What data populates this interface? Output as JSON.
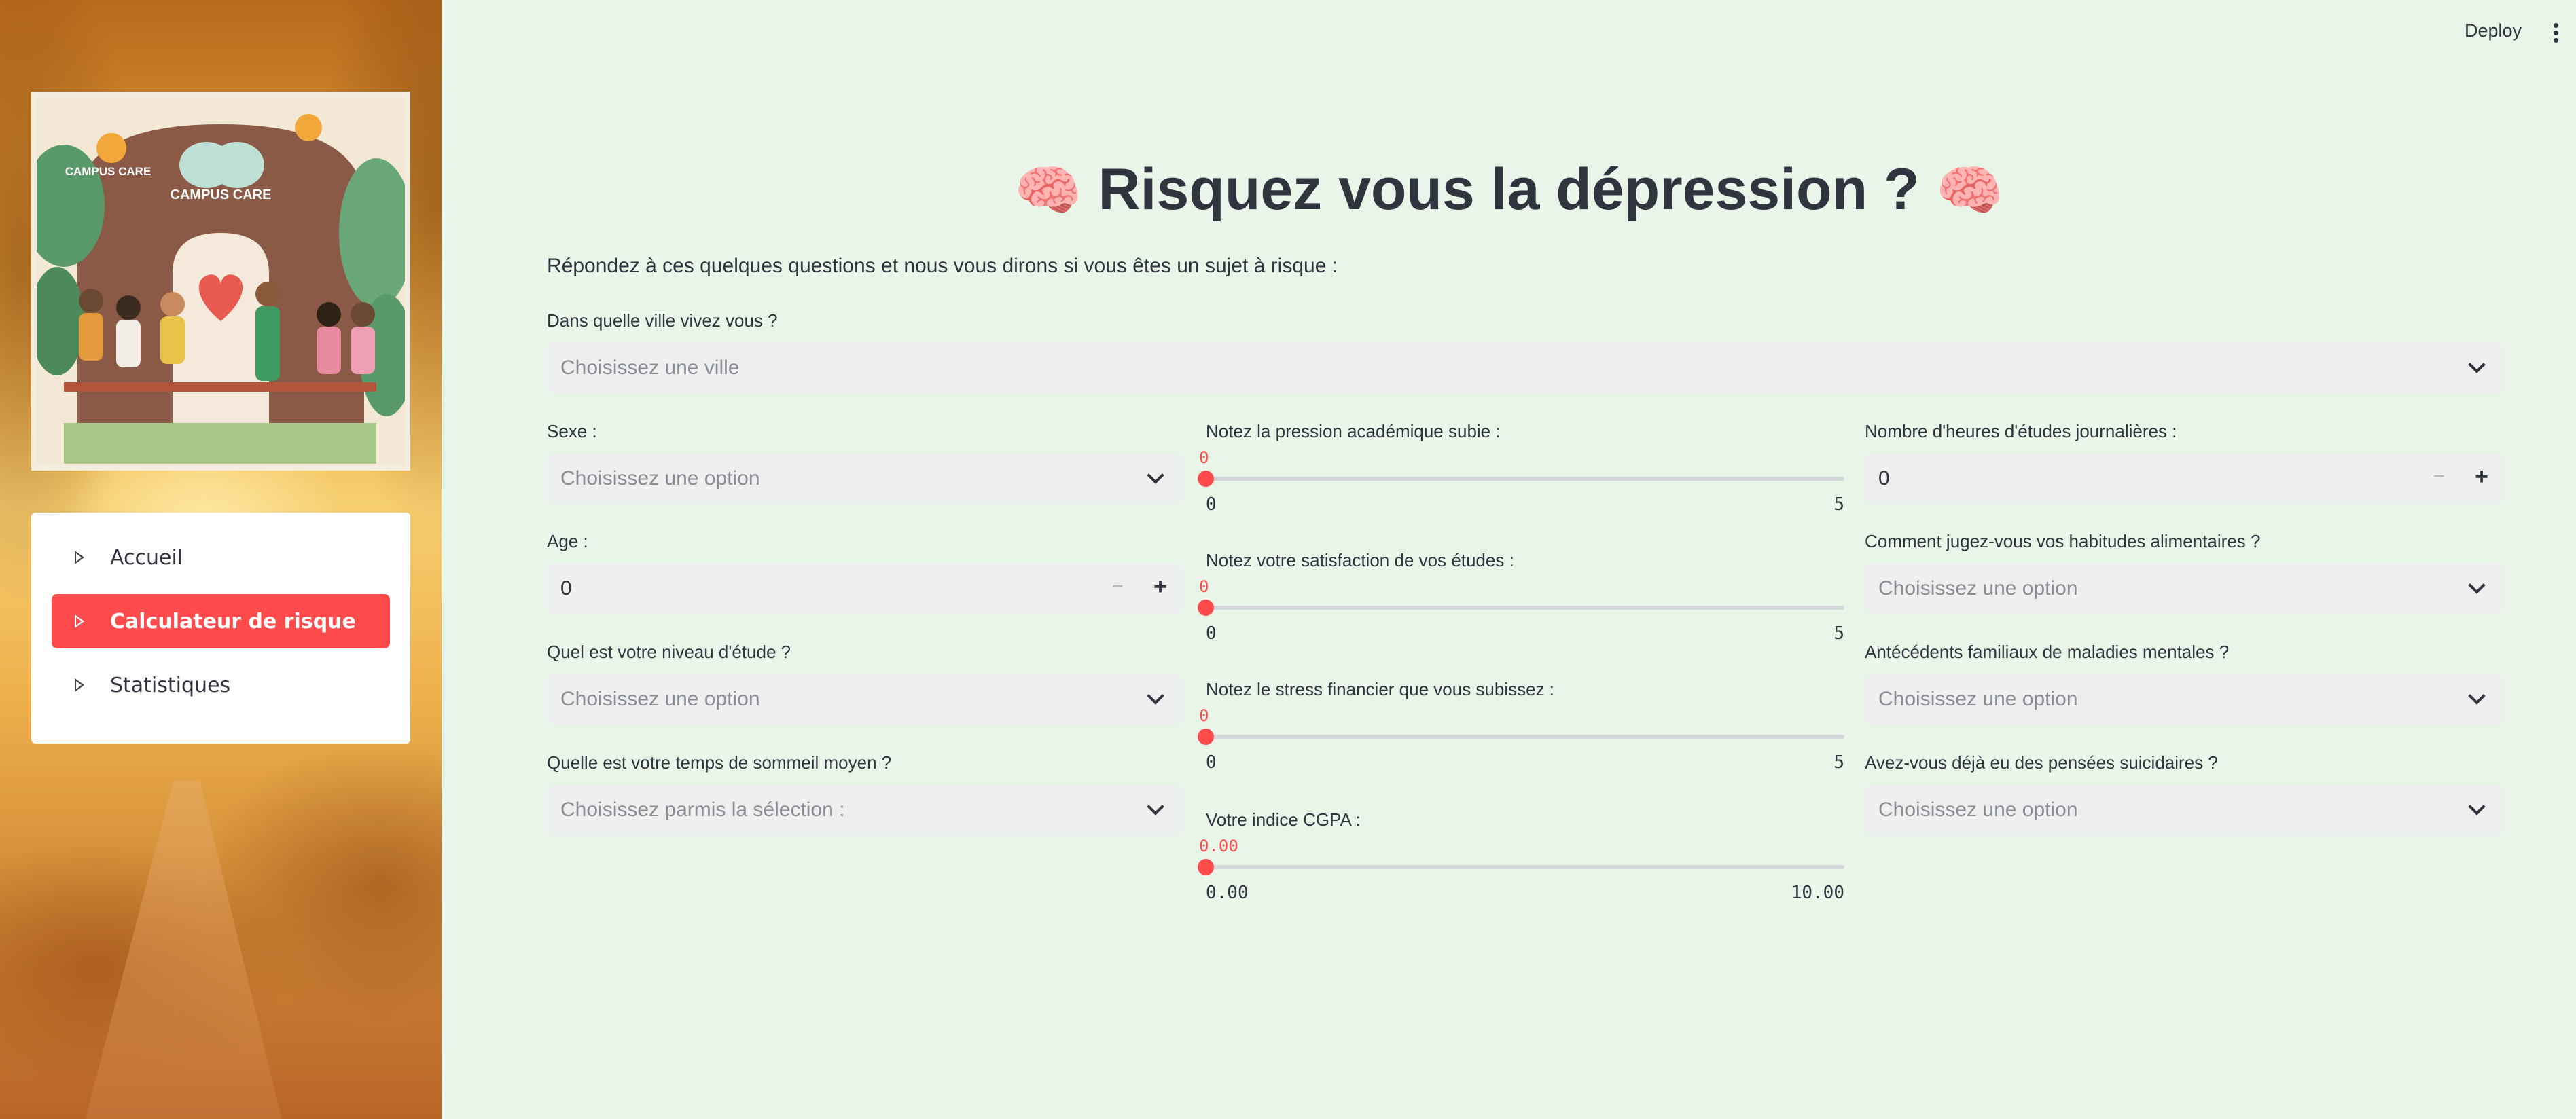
{
  "topbar": {
    "deploy_label": "Deploy",
    "menu_icon": "kebab-menu-icon"
  },
  "sidebar": {
    "logo_text_1": "CAMPUS CARE",
    "logo_text_2": "CAMPUS CARE",
    "nav": [
      {
        "label": "Accueil",
        "active": false
      },
      {
        "label": "Calculateur de risque",
        "active": true
      },
      {
        "label": "Statistiques",
        "active": false
      }
    ]
  },
  "main": {
    "title": "Risquez vous la dépression ?",
    "title_emoji": "🧠",
    "intro": "Répondez à ces quelques questions et nous vous dirons si vous êtes un sujet à risque :",
    "ville": {
      "label": "Dans quelle ville vivez vous ?",
      "placeholder": "Choisissez une ville"
    },
    "col1": {
      "sexe": {
        "label": "Sexe :",
        "placeholder": "Choisissez une option"
      },
      "age": {
        "label": "Age :",
        "value": "0",
        "minus": "−",
        "plus": "+"
      },
      "niveau": {
        "label": "Quel est votre niveau d'étude ?",
        "placeholder": "Choisissez une option"
      },
      "sommeil": {
        "label": "Quelle est votre temps de sommeil moyen ?",
        "placeholder": "Choisissez parmis la sélection :"
      }
    },
    "col2": {
      "pression": {
        "label": "Notez la pression académique subie :",
        "value": "0",
        "min": "0",
        "max": "5",
        "fraction": 0
      },
      "satisfaction": {
        "label": "Notez votre satisfaction de vos études :",
        "value": "0",
        "min": "0",
        "max": "5",
        "fraction": 0
      },
      "stress": {
        "label": "Notez le stress financier que vous subissez :",
        "value": "0",
        "min": "0",
        "max": "5",
        "fraction": 0
      },
      "cgpa": {
        "label": "Votre indice CGPA :",
        "value": "0.00",
        "min": "0.00",
        "max": "10.00",
        "fraction": 0
      }
    },
    "col3": {
      "heures": {
        "label": "Nombre d'heures d'études journalières :",
        "value": "0",
        "minus": "−",
        "plus": "+"
      },
      "alimentation": {
        "label": "Comment jugez-vous vos habitudes alimentaires ?",
        "placeholder": "Choisissez une option"
      },
      "antecedents": {
        "label": "Antécédents familiaux de maladies mentales ?",
        "placeholder": "Choisissez une option"
      },
      "suicide": {
        "label": "Avez-vous déjà eu des pensées suicidaires ?",
        "placeholder": "Choisissez une option"
      }
    }
  },
  "colors": {
    "accent": "#ff4b4b",
    "background": "#e8f5e8",
    "input_bg": "#eef0f0",
    "text": "#31333f"
  }
}
